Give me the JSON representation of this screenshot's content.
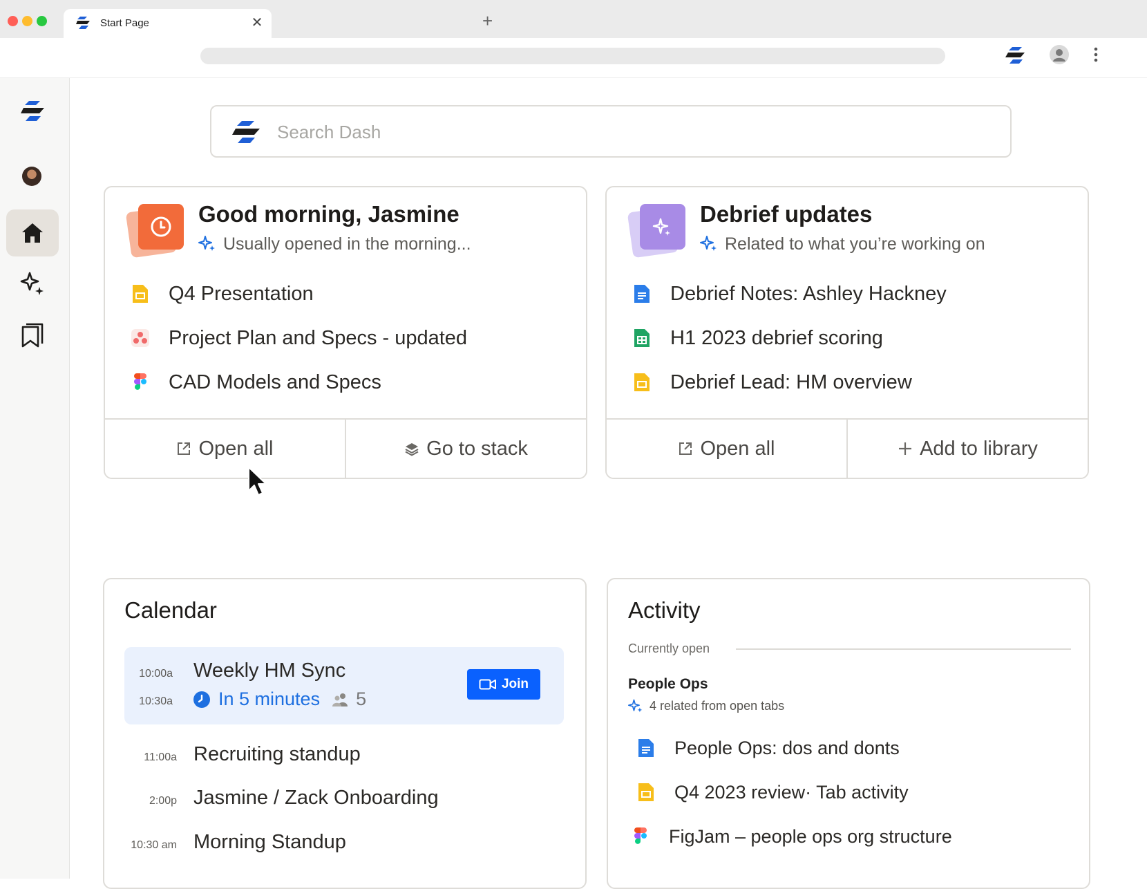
{
  "browser": {
    "tab_title": "Start Page",
    "close_glyph": "✕",
    "new_tab_glyph": "+"
  },
  "search": {
    "placeholder": "Search Dash"
  },
  "greeting_card": {
    "title": "Good morning, Jasmine",
    "subtitle": "Usually opened in the morning...",
    "items": [
      {
        "label": "Q4 Presentation",
        "icon": "slides-icon"
      },
      {
        "label": "Project Plan and Specs - updated",
        "icon": "asana-icon"
      },
      {
        "label": "CAD Models and Specs",
        "icon": "figma-icon"
      }
    ],
    "actions": {
      "open_all": "Open all",
      "go_to_stack": "Go to stack"
    }
  },
  "debrief_card": {
    "title": "Debrief updates",
    "subtitle": "Related to what you’re working on",
    "items": [
      {
        "label": "Debrief Notes: Ashley Hackney",
        "icon": "docs-icon"
      },
      {
        "label": "H1 2023 debrief scoring",
        "icon": "sheets-icon"
      },
      {
        "label": "Debrief Lead: HM overview",
        "icon": "slides-icon"
      }
    ],
    "actions": {
      "open_all": "Open all",
      "add_to_library": "Add to library"
    }
  },
  "calendar": {
    "title": "Calendar",
    "highlight": {
      "start": "10:00a",
      "end": "10:30a",
      "title": "Weekly HM Sync",
      "status": "In 5 minutes",
      "attendees": "5",
      "join_label": "Join"
    },
    "events": [
      {
        "time": "11:00a",
        "title": "Recruiting standup"
      },
      {
        "time": "2:00p",
        "title": "Jasmine / Zack Onboarding"
      },
      {
        "time": "10:30 am",
        "title": "Morning Standup"
      }
    ]
  },
  "activity": {
    "title": "Activity",
    "section_label": "Currently open",
    "group_title": "People Ops",
    "group_related": "4 related from open tabs",
    "items": [
      {
        "label": "People Ops: dos and donts",
        "icon": "docs-icon"
      },
      {
        "label": "Q4 2023 review· Tab activity",
        "icon": "slides-icon"
      },
      {
        "label": "FigJam – people ops org structure",
        "icon": "figma-icon"
      }
    ]
  },
  "colors": {
    "accent_blue": "#0a61fe",
    "link_blue": "#1d6fe0",
    "orange_tile": "#f26b3a",
    "purple_tile": "#a88be6",
    "highlight_bg": "#eaf1fd"
  }
}
